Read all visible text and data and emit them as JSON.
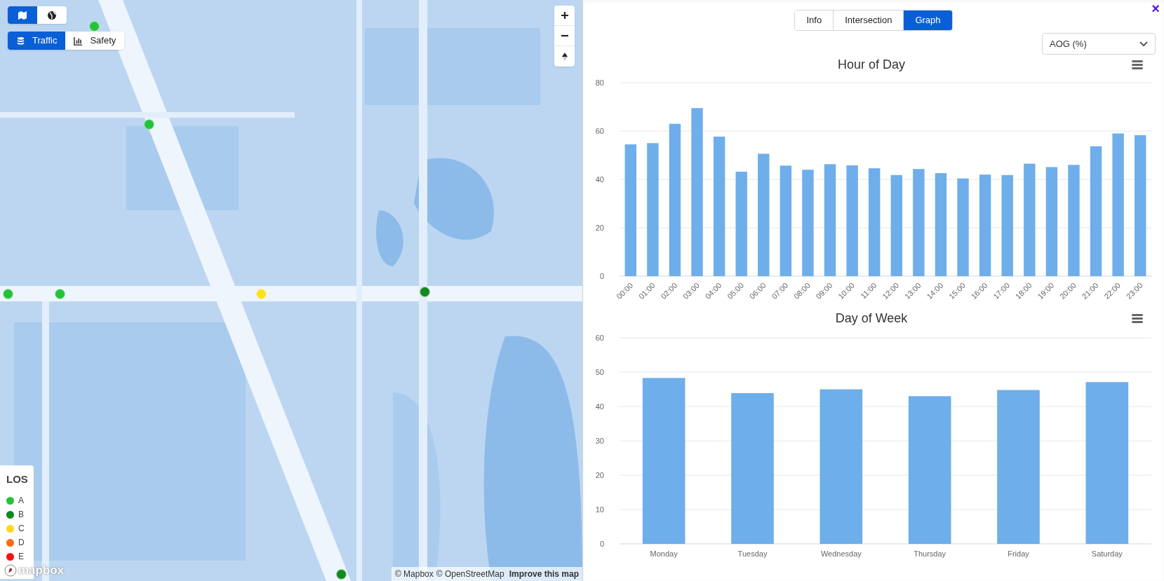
{
  "map": {
    "view_buttons": [
      {
        "kind": "map",
        "selected": true
      },
      {
        "kind": "globe",
        "selected": false
      }
    ],
    "layer_tabs": [
      {
        "label": "Traffic",
        "kind": "database",
        "selected": true
      },
      {
        "label": "Safety",
        "kind": "chart",
        "selected": false
      }
    ],
    "markers": [
      {
        "color": "#22c33a"
      },
      {
        "color": "#22c33a"
      },
      {
        "color": "#22c33a"
      },
      {
        "color": "#22c33a"
      },
      {
        "color": "#ffe11a"
      },
      {
        "color": "#0f8a1f"
      },
      {
        "color": "#0f8a1f"
      }
    ],
    "legend": {
      "title": "LOS",
      "items": [
        {
          "label": "A",
          "color": "#22c33a"
        },
        {
          "label": "B",
          "color": "#0f8a1f"
        },
        {
          "label": "C",
          "color": "#ffd91a"
        },
        {
          "label": "D",
          "color": "#ff6a13"
        },
        {
          "label": "E",
          "color": "#ff1010"
        }
      ]
    },
    "logo": "mapbox",
    "attribution": [
      "© Mapbox",
      "© OpenStreetMap"
    ],
    "improve_link": "Improve this map"
  },
  "panel": {
    "tabs": [
      {
        "label": "Info",
        "selected": false
      },
      {
        "label": "Intersection",
        "selected": false
      },
      {
        "label": "Graph",
        "selected": true
      }
    ],
    "close": "×",
    "metric_dropdown": {
      "value": "AOG (%)"
    },
    "charts": [
      {
        "chart_data": {
          "type": "bar",
          "title": "Hour of Day",
          "categories": [
            "00:00",
            "01:00",
            "02:00",
            "03:00",
            "04:00",
            "05:00",
            "06:00",
            "07:00",
            "08:00",
            "09:00",
            "10:00",
            "11:00",
            "12:00",
            "13:00",
            "14:00",
            "15:00",
            "16:00",
            "17:00",
            "18:00",
            "19:00",
            "20:00",
            "21:00",
            "22:00",
            "23:00"
          ],
          "series": [
            {
              "color": "#6eaeea",
              "values": [
                54.5,
                55,
                63,
                69.5,
                57.7,
                43.2,
                50.6,
                45.7,
                44,
                46.3,
                45.8,
                44.6,
                41.8,
                44.3,
                42.6,
                40.4,
                42,
                41.8,
                46.5,
                45.1,
                46,
                53.7,
                59,
                58.3
              ]
            }
          ],
          "ylim": [
            0,
            80
          ],
          "yticks": [
            0,
            20,
            40,
            60,
            80
          ],
          "grid": true
        }
      },
      {
        "chart_data": {
          "type": "bar",
          "title": "Day of Week",
          "categories": [
            "Monday",
            "Tuesday",
            "Wednesday",
            "Thursday",
            "Friday",
            "Saturday"
          ],
          "series": [
            {
              "color": "#6eaeea",
              "values": [
                48.3,
                43.9,
                45,
                43,
                44.8,
                47.1
              ]
            }
          ],
          "ylim": [
            0,
            60
          ],
          "yticks": [
            0,
            10,
            20,
            30,
            40,
            50,
            60
          ],
          "grid": true
        }
      }
    ]
  }
}
